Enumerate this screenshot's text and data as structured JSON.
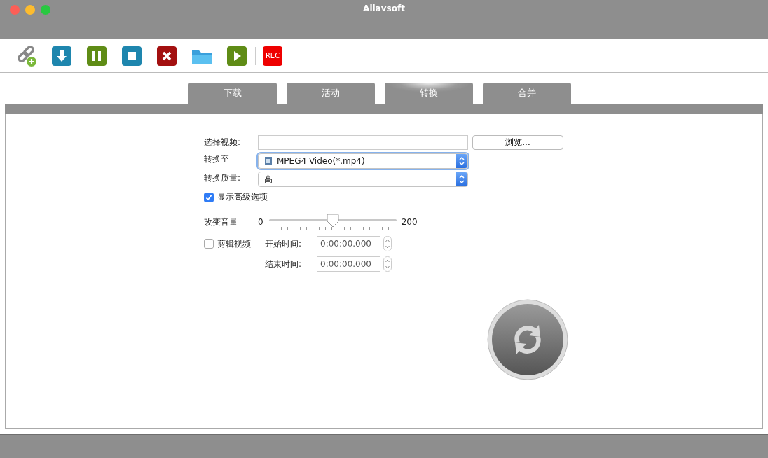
{
  "window": {
    "title": "Allavsoft"
  },
  "toolbar": {
    "rec_label": "REC"
  },
  "tabs": [
    {
      "label": "下载",
      "selected": false
    },
    {
      "label": "活动",
      "selected": false
    },
    {
      "label": "转换",
      "selected": true
    },
    {
      "label": "合并",
      "selected": false
    }
  ],
  "form": {
    "select_video": {
      "label": "选择视频:"
    },
    "browse_button": "浏览...",
    "convert_to": {
      "label": "转换至",
      "value": "MPEG4 Video(*.mp4)"
    },
    "quality": {
      "label": "转换质量:",
      "value": "高"
    },
    "show_advanced": {
      "label": "显示高级选项",
      "checked": true
    },
    "volume": {
      "label": "改变音量",
      "min_label": "0",
      "max_label": "200",
      "level": 0.5
    },
    "trim": {
      "label": "剪辑视频",
      "checked": false
    },
    "start_time": {
      "label": "开始时间:",
      "value": "0:00:00.000"
    },
    "end_time": {
      "label": "结束时间:",
      "value": "0:00:00.000"
    }
  }
}
